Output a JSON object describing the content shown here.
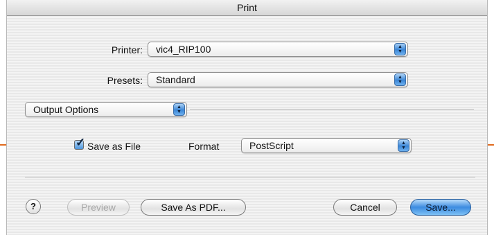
{
  "window": {
    "title": "Print"
  },
  "printer": {
    "label": "Printer:",
    "value": "vic4_RIP100"
  },
  "presets": {
    "label": "Presets:",
    "value": "Standard"
  },
  "panel": {
    "value": "Output Options"
  },
  "save_as_file": {
    "label": "Save as File",
    "checked": true
  },
  "format": {
    "label": "Format",
    "value": "PostScript"
  },
  "buttons": {
    "help": "?",
    "preview": "Preview",
    "save_as_pdf": "Save As PDF...",
    "cancel": "Cancel",
    "save": "Save..."
  },
  "colors": {
    "accent": "#3b86d6",
    "callout_line": "#e06a1c"
  }
}
